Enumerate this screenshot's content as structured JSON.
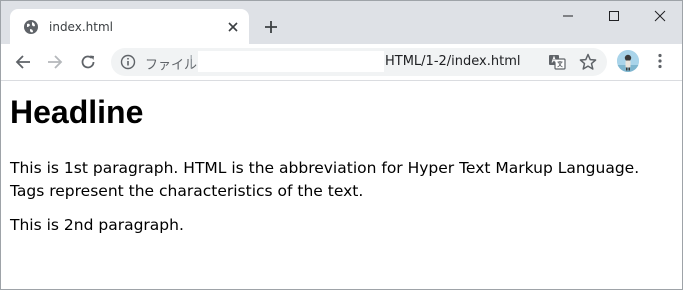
{
  "tab": {
    "title": "index.html"
  },
  "address_bar": {
    "scheme_label": "ファイル",
    "separator": "|",
    "url_visible_part": "HTML/1-2/index.html"
  },
  "page": {
    "headline": "Headline",
    "paragraphs": [
      "This is 1st paragraph. HTML is the abbreviation for Hyper Text Markup Language. Tags represent the characteristics of the text.",
      "This is 2nd paragraph."
    ]
  },
  "icons": {
    "favicon": "globe-icon",
    "tab_close": "close-icon",
    "new_tab": "plus-icon",
    "back": "arrow-left-icon",
    "forward": "arrow-right-icon",
    "reload": "reload-icon",
    "site_info": "info-icon",
    "translate": "translate-icon",
    "bookmark": "star-icon",
    "profile": "avatar",
    "menu": "kebab-menu-icon",
    "minimize": "minimize-icon",
    "maximize": "maximize-icon",
    "close_window": "close-window-icon"
  },
  "colors": {
    "tabstrip_bg": "#dee1e6",
    "omnibox_bg": "#f1f3f4",
    "icon_gray": "#5f6368"
  }
}
